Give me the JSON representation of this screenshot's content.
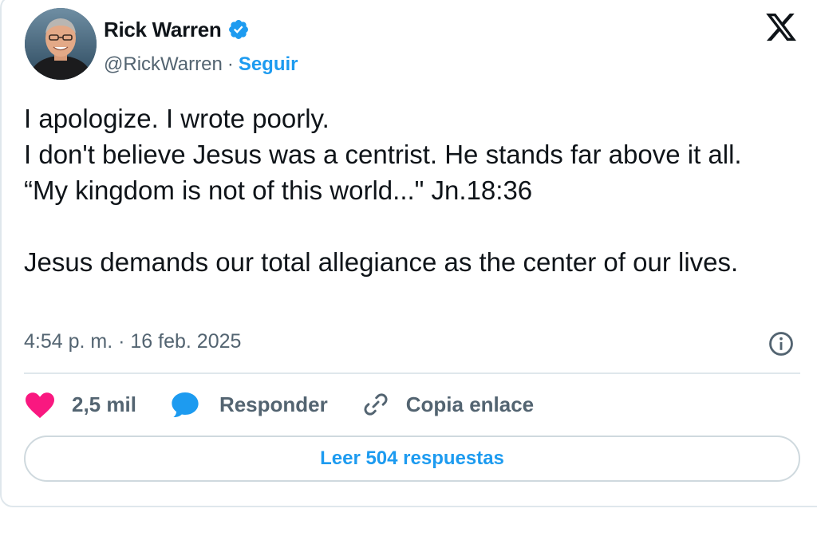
{
  "author": {
    "display_name": "Rick Warren",
    "handle": "@RickWarren",
    "separator": "·",
    "follow_label": "Seguir",
    "verified": true
  },
  "tweet": {
    "text": "I apologize. I wrote poorly.\nI don't believe Jesus was a centrist. He stands far above it all.  “My kingdom is not of this world...\" Jn.18:36\n\nJesus demands our total allegiance as the center of our lives.",
    "timestamp": "4:54 p. m. · 16 feb. 2025"
  },
  "actions": {
    "like_count": "2,5 mil",
    "reply_label": "Responder",
    "copy_label": "Copia enlace"
  },
  "read_replies_label": "Leer 504 respuestas",
  "icons": {
    "brand_logo": "x-logo-icon",
    "verified": "verified-badge-icon",
    "info": "info-icon",
    "like": "heart-icon",
    "reply": "speech-bubble-icon",
    "copy": "link-icon"
  },
  "colors": {
    "accent": "#1d9bf0",
    "like": "#f91880",
    "secondary_text": "#536471",
    "border": "#dfe7ec"
  }
}
